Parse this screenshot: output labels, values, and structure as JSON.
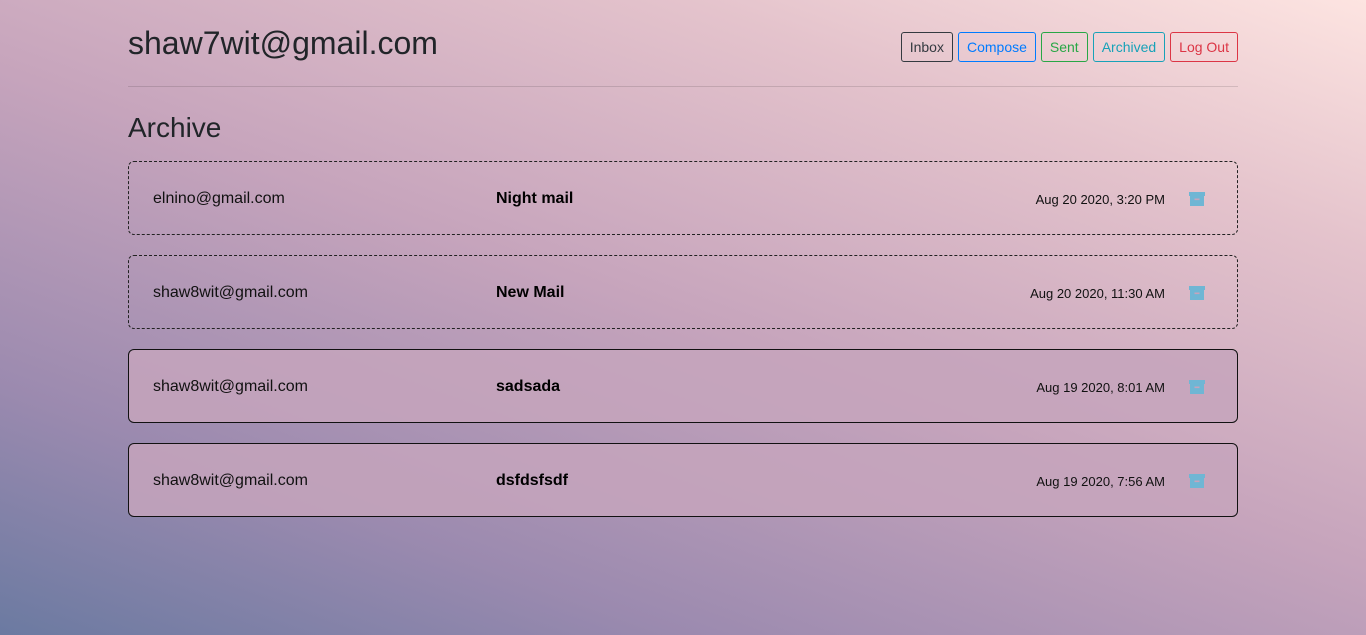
{
  "header": {
    "user_email": "shaw7wit@gmail.com"
  },
  "nav": {
    "inbox": "Inbox",
    "compose": "Compose",
    "sent": "Sent",
    "archived": "Archived",
    "logout": "Log Out"
  },
  "colors": {
    "inbox": "#343a40",
    "compose": "#007bff",
    "sent": "#28a745",
    "archived": "#17a2b8",
    "logout": "#dc3545",
    "archive_icon": "#6fb6d4"
  },
  "section_title": "Archive",
  "emails": [
    {
      "sender": "elnino@gmail.com",
      "subject": "Night mail",
      "timestamp": "Aug 20 2020, 3:20 PM",
      "read": true,
      "icon": "archive-box-icon"
    },
    {
      "sender": "shaw8wit@gmail.com",
      "subject": "New Mail",
      "timestamp": "Aug 20 2020, 11:30 AM",
      "read": true,
      "icon": "archive-box-icon"
    },
    {
      "sender": "shaw8wit@gmail.com",
      "subject": "sadsada",
      "timestamp": "Aug 19 2020, 8:01 AM",
      "read": false,
      "icon": "archive-box-icon"
    },
    {
      "sender": "shaw8wit@gmail.com",
      "subject": "dsfdsfsdf",
      "timestamp": "Aug 19 2020, 7:56 AM",
      "read": false,
      "icon": "archive-box-icon"
    }
  ]
}
